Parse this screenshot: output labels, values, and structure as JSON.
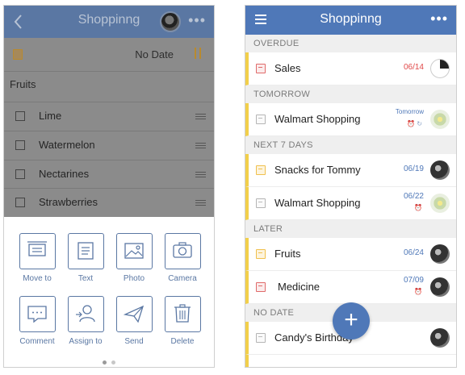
{
  "left_screen": {
    "header": {
      "title": "Shoppinng",
      "back_icon": "chevron-left-icon",
      "more_icon": "more-icon"
    },
    "due_row": {
      "due_text": "No Date"
    },
    "list": {
      "title": "Fruits",
      "items": [
        "Lime",
        "Watermelon",
        "Nectarines",
        "Strawberries"
      ]
    },
    "actions": [
      {
        "label": "Move to",
        "icon": "move-to-icon"
      },
      {
        "label": "Text",
        "icon": "text-icon"
      },
      {
        "label": "Photo",
        "icon": "photo-icon"
      },
      {
        "label": "Camera",
        "icon": "camera-icon"
      },
      {
        "label": "Comment",
        "icon": "comment-icon"
      },
      {
        "label": "Assign to",
        "icon": "assign-icon"
      },
      {
        "label": "Send",
        "icon": "send-icon"
      },
      {
        "label": "Delete",
        "icon": "trash-icon"
      }
    ]
  },
  "right_screen": {
    "header": {
      "title": "Shoppinng",
      "menu_icon": "menu-icon",
      "more_icon": "more-icon"
    },
    "sections": [
      {
        "label": "OVERDUE"
      },
      {
        "label": "TOMORROW"
      },
      {
        "label": "NEXT 7 DAYS"
      },
      {
        "label": "LATER"
      },
      {
        "label": "NO DATE"
      }
    ],
    "tasks": [
      {
        "title": "Sales",
        "date": "06/14"
      },
      {
        "title": "Walmart Shopping",
        "date": "Tomorrow"
      },
      {
        "title": "Snacks for Tommy",
        "date": "06/19"
      },
      {
        "title": "Walmart Shopping",
        "date": "06/22"
      },
      {
        "title": "Fruits",
        "date": "06/24"
      },
      {
        "title": "Medicine",
        "date": "07/09"
      },
      {
        "title": "Candy's Birthday",
        "date": ""
      }
    ]
  },
  "colors": {
    "accent": "#4f78b8",
    "overdue": "#e04848",
    "left_bar": "#f2cf4a"
  }
}
